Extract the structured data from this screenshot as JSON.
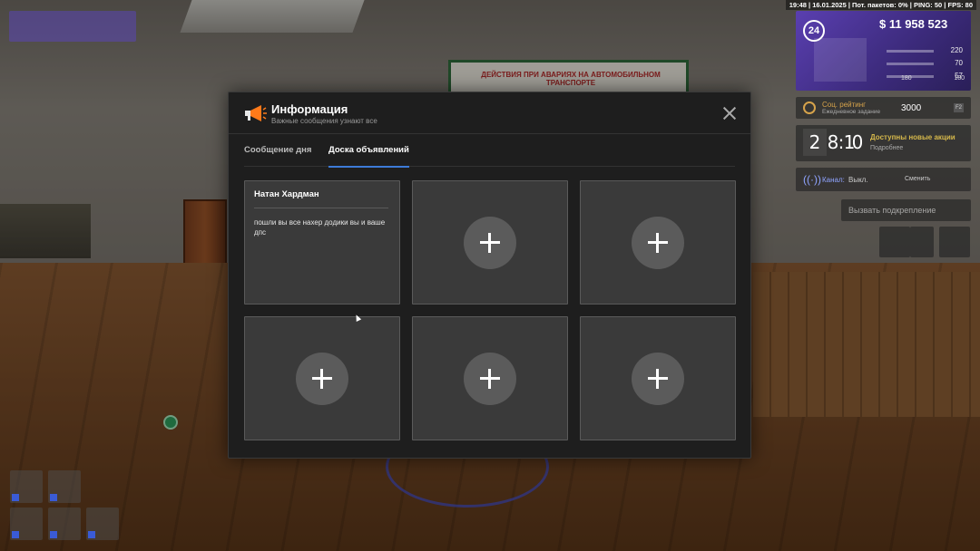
{
  "status_bar": {
    "text": "19:48 | 16.01.2025 | Пот. пакетов: 0% | PING: 50 | FPS: 80"
  },
  "hud": {
    "level": "24",
    "money": "$ 11 958 523",
    "stats": [
      "220",
      "70",
      "57",
      "180",
      "180"
    ],
    "accent_color": "#5a3fb0"
  },
  "rating": {
    "label": "Соц. рейтинг",
    "sub": "Ежедневное задание",
    "value": "3000",
    "key": "F2"
  },
  "timer": {
    "digits": [
      "2",
      "8",
      "1",
      "0"
    ],
    "promo": "Доступны новые акции",
    "more": "Подробнее"
  },
  "channel": {
    "label": "Канал:",
    "state": "Выкл.",
    "switch": "Сменить"
  },
  "support": {
    "label": "Вызвать подкрепление"
  },
  "modal": {
    "title": "Информация",
    "subtitle": "Важные сообщения узнают все",
    "tabs": [
      {
        "label": "Сообщение дня",
        "active": false
      },
      {
        "label": "Доска объявлений",
        "active": true
      }
    ],
    "cards": [
      {
        "author": "Натан Хардман",
        "message": "пошли вы все нахер додики вы и ваше дпс"
      },
      {
        "empty": true
      },
      {
        "empty": true
      },
      {
        "empty": true
      },
      {
        "empty": true
      },
      {
        "empty": true
      }
    ],
    "tab_underline_color": "#3d7bd8"
  },
  "poster": {
    "text": "ДЕЙСТВИЯ ПРИ АВАРИЯХ НА АВТОМОБИЛЬНОМ ТРАНСПОРТЕ"
  }
}
